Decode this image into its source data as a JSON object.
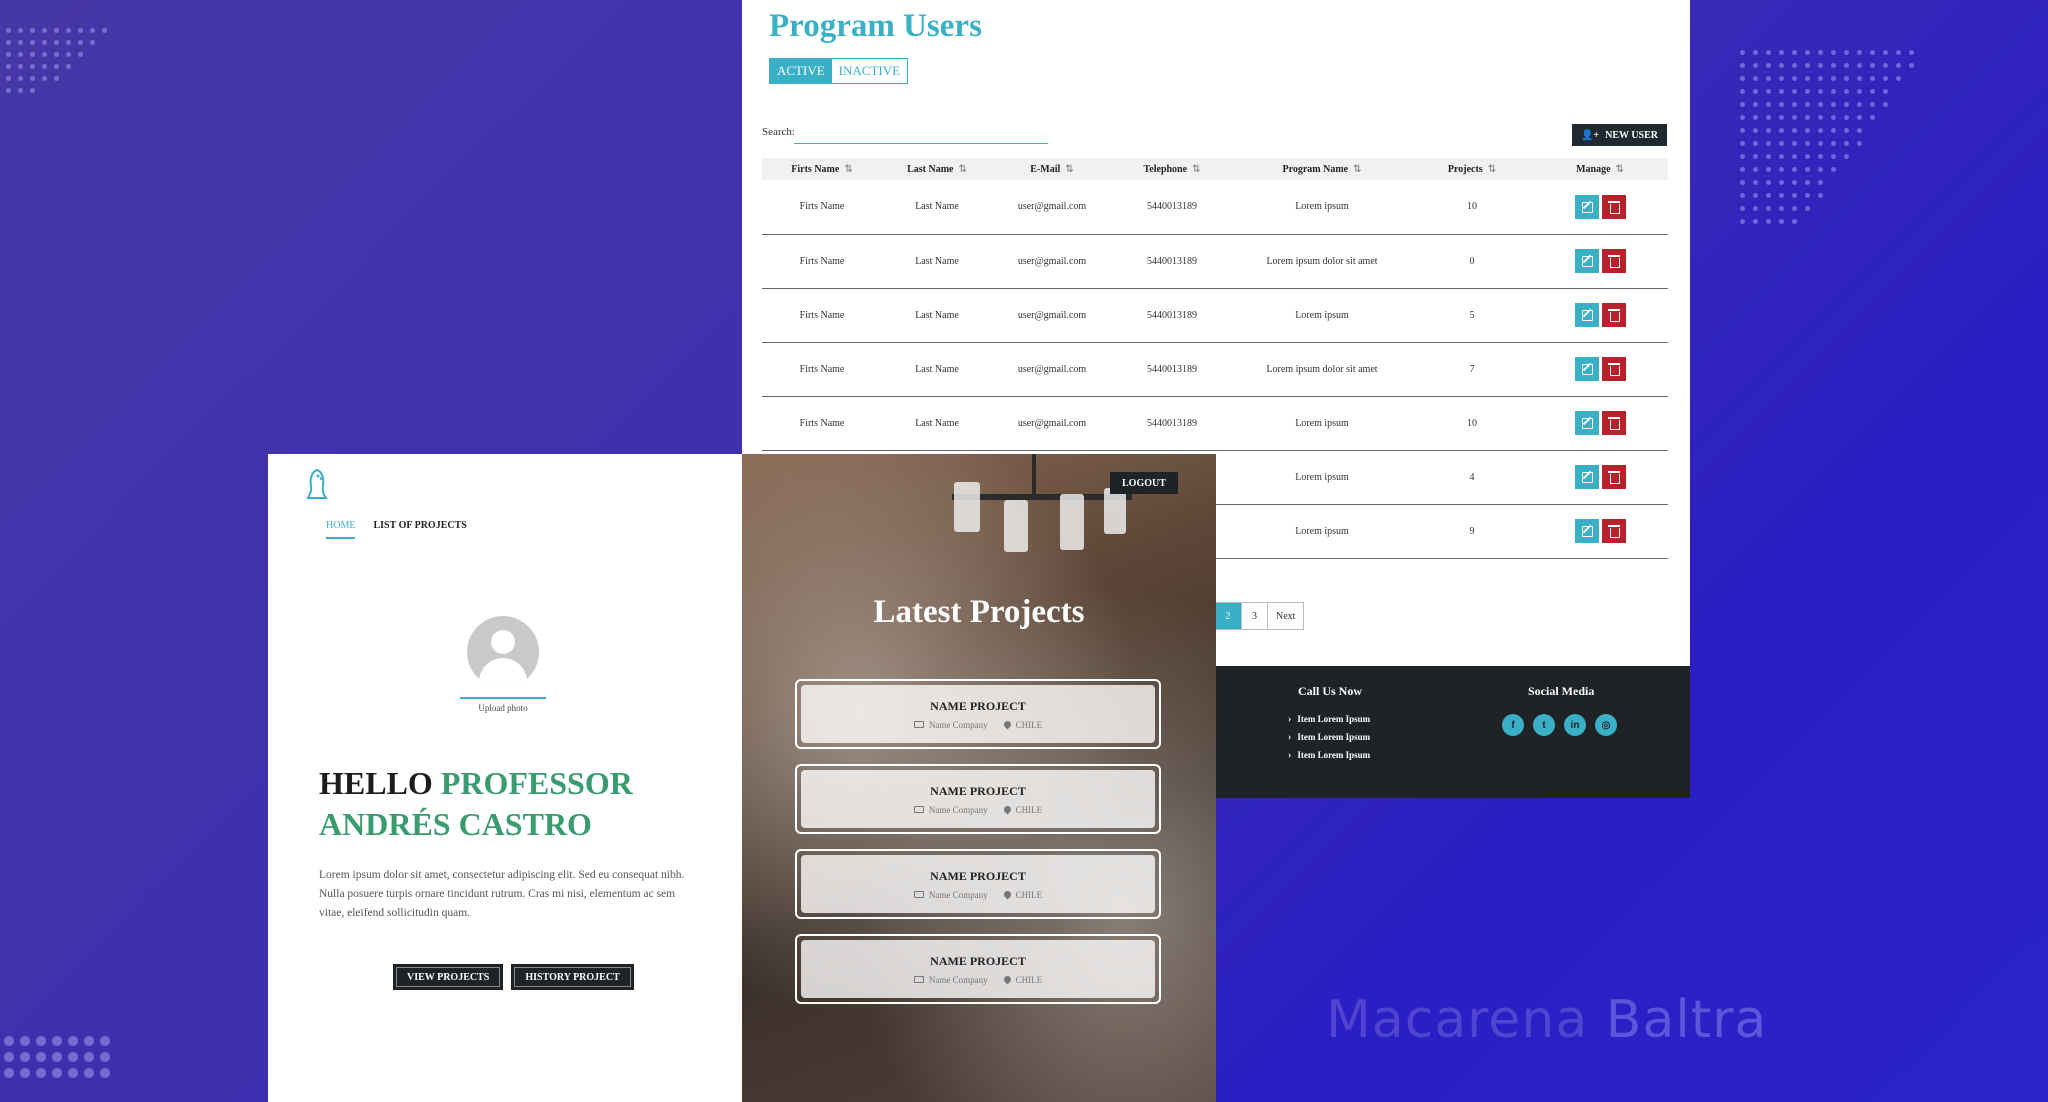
{
  "users_page": {
    "title": "Program Users",
    "tabs": [
      {
        "label": "ACTIVE",
        "active": true
      },
      {
        "label": "INACTIVE",
        "active": false
      }
    ],
    "search_label": "Search:",
    "search_value": "",
    "new_user_label": "NEW USER",
    "columns": [
      "Firts Name",
      "Last Name",
      "E-Mail",
      "Telephone",
      "Program Name",
      "Projects",
      "Manage"
    ],
    "rows": [
      {
        "first": "Firts Name",
        "last": "Last Name",
        "email": "user@gmail.com",
        "phone": "5440013189",
        "program": "Lorem ipsum",
        "projects": "10"
      },
      {
        "first": "Firts Name",
        "last": "Last Name",
        "email": "user@gmail.com",
        "phone": "5440013189",
        "program": "Lorem ipsum dolor sit amet",
        "projects": "0"
      },
      {
        "first": "Firts Name",
        "last": "Last Name",
        "email": "user@gmail.com",
        "phone": "5440013189",
        "program": "Lorem ipsum",
        "projects": "5"
      },
      {
        "first": "Firts Name",
        "last": "Last Name",
        "email": "user@gmail.com",
        "phone": "5440013189",
        "program": "Lorem ipsum dolor sit amet",
        "projects": "7"
      },
      {
        "first": "Firts Name",
        "last": "Last Name",
        "email": "user@gmail.com",
        "phone": "5440013189",
        "program": "Lorem ipsum",
        "projects": "10"
      },
      {
        "first": "",
        "last": "",
        "email": "",
        "phone": "",
        "program": "Lorem ipsum",
        "projects": "4"
      },
      {
        "first": "",
        "last": "",
        "email": "",
        "phone": "",
        "program": "Lorem ipsum",
        "projects": "9"
      }
    ],
    "pagination": {
      "pages": [
        "2",
        "3"
      ],
      "active": "2",
      "next": "Next"
    },
    "footer": {
      "call_title": "Call Us Now",
      "items": [
        "Item Lorem Ipsum",
        "Item Lorem Ipsum",
        "Item Lorem Ipsum"
      ],
      "social_title": "Social Media",
      "social": [
        {
          "icon": "facebook-icon",
          "glyph": "f"
        },
        {
          "icon": "twitter-icon",
          "glyph": "t"
        },
        {
          "icon": "linkedin-icon",
          "glyph": "in"
        },
        {
          "icon": "instagram-icon",
          "glyph": "◎"
        }
      ]
    }
  },
  "home_page": {
    "nav": [
      {
        "label": "HOME",
        "active": true
      },
      {
        "label": "LIST OF PROJECTS",
        "active": false
      }
    ],
    "upload_label": "Upload photo",
    "greeting_dark": "HELLO",
    "greeting_green_1": "PROFESSOR",
    "greeting_green_2": "ANDRÉS CASTRO",
    "body": "Lorem ipsum dolor sit amet, consectetur adipiscing elit. Sed eu consequat nibh. Nulla posuere turpis ornare tincidunt rutrum. Cras mi nisi, elementum ac sem vitae, eleifend sollicitudin quam.",
    "buttons": [
      "VIEW PROJECTS",
      "HISTORY PROJECT"
    ]
  },
  "projects_page": {
    "logout_label": "LOGOUT",
    "title": "Latest Projects",
    "projects": [
      {
        "name": "NAME PROJECT",
        "company": "Name Company",
        "country": "CHILE"
      },
      {
        "name": "NAME PROJECT",
        "company": "Name Company",
        "country": "CHILE"
      },
      {
        "name": "NAME PROJECT",
        "company": "Name Company",
        "country": "CHILE"
      },
      {
        "name": "NAME PROJECT",
        "company": "Name Company",
        "country": "CHILE"
      }
    ]
  },
  "watermark": {
    "first": "Macarena",
    "last": "Baltra"
  },
  "colors": {
    "accent": "#3ab0c7",
    "danger": "#b8202a",
    "dark": "#1f2326",
    "green": "#3a9c6e",
    "background": "#3d2fb0"
  }
}
